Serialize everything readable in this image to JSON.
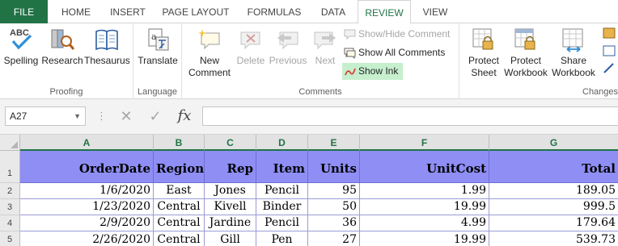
{
  "tabs": [
    {
      "label": "FILE"
    },
    {
      "label": "HOME"
    },
    {
      "label": "INSERT"
    },
    {
      "label": "PAGE LAYOUT"
    },
    {
      "label": "FORMULAS"
    },
    {
      "label": "DATA"
    },
    {
      "label": "REVIEW"
    },
    {
      "label": "VIEW"
    }
  ],
  "ribbon": {
    "proofing": {
      "label": "Proofing",
      "spelling": "Spelling",
      "spelling_icon_text": "ABC",
      "research": "Research",
      "thesaurus": "Thesaurus"
    },
    "language": {
      "label": "Language",
      "translate": "Translate"
    },
    "comments": {
      "label": "Comments",
      "new_line1": "New",
      "new_line2": "Comment",
      "delete": "Delete",
      "previous": "Previous",
      "next": "Next",
      "show_hide": "Show/Hide Comment",
      "show_all": "Show All Comments",
      "show_ink": "Show Ink"
    },
    "changes": {
      "label": "Changes",
      "protect_sheet_1": "Protect",
      "protect_sheet_2": "Sheet",
      "protect_wb_1": "Protect",
      "protect_wb_2": "Workbook",
      "share_wb_1": "Share",
      "share_wb_2": "Workbook"
    }
  },
  "formula_bar": {
    "name_box": "A27",
    "fx": "fx",
    "cancel": "✕",
    "enter": "✓",
    "formula": ""
  },
  "grid": {
    "columns": [
      "A",
      "B",
      "C",
      "D",
      "E",
      "F",
      "G"
    ],
    "rows": [
      "1",
      "2",
      "3",
      "4",
      "5"
    ],
    "header": [
      "OrderDate",
      "Region",
      "Rep",
      "Item",
      "Units",
      "UnitCost",
      "Total"
    ],
    "data": [
      [
        "1/6/2020",
        "East",
        "Jones",
        "Pencil",
        "95",
        "1.99",
        "189.05"
      ],
      [
        "1/23/2020",
        "Central",
        "Kivell",
        "Binder",
        "50",
        "19.99",
        "999.5"
      ],
      [
        "2/9/2020",
        "Central",
        "Jardine",
        "Pencil",
        "36",
        "4.99",
        "179.64"
      ],
      [
        "2/26/2020",
        "Central",
        "Gill",
        "Pen",
        "27",
        "19.99",
        "539.73"
      ]
    ]
  },
  "colors": {
    "accent": "#217346",
    "header_fill": "#8e8ef5",
    "show_ink_highlight": "#c6efce"
  }
}
